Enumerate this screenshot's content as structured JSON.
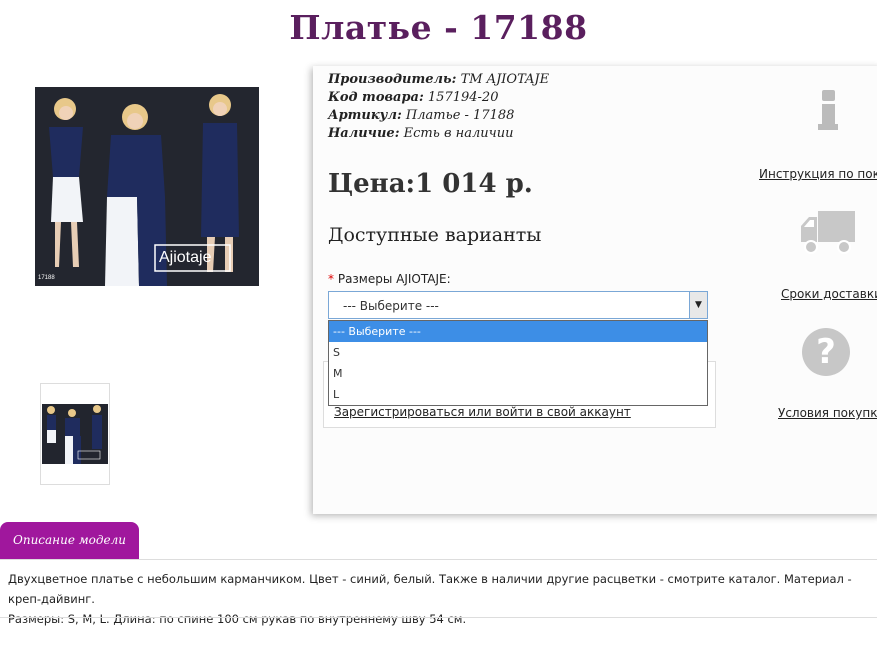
{
  "product": {
    "title": "Платье - 17188",
    "manufacturer_label": "Производитель:",
    "manufacturer_value": "ТМ AJIOTAJE",
    "code_label": "Код товара:",
    "code_value": "157194-20",
    "article_label": "Артикул:",
    "article_value": "Платье - 17188",
    "availability_label": "Наличие:",
    "availability_value": "Есть в наличии",
    "price": "Цена:1 014 р."
  },
  "image": {
    "brand_overlay": "Ajiotaje",
    "code_overlay": "17188"
  },
  "options": {
    "heading": "Доступные варианты",
    "required_mark": "*",
    "size_label": "Размеры AJIOTAJE:",
    "select_value": "--- Выберите ---",
    "dropdown": [
      "--- Выберите ---",
      "S",
      "M",
      "L"
    ],
    "selected_index": 0
  },
  "account": {
    "login_link": "Зарегистрироваться или войти в свой аккаунт"
  },
  "sidebar": {
    "instructions": "Инструкция по покупке",
    "delivery": "Сроки доставки",
    "terms": "Условия покупки",
    "question_glyph": "?"
  },
  "tabs": {
    "description": "Описание модели"
  },
  "description": {
    "line1": "Двухцветное платье с небольшим карманчиком. Цвет - синий, белый. Также в наличии другие расцветки - смотрите каталог. Материал - креп-дайвинг.",
    "line2": "Размеры: S, M, L. Длина: по спине 100 см рукав по внутреннему шву 54 см."
  },
  "colors": {
    "title": "#5a1f5e",
    "tab": "#a0179d",
    "dropdown_highlight": "#3d8ee6"
  }
}
